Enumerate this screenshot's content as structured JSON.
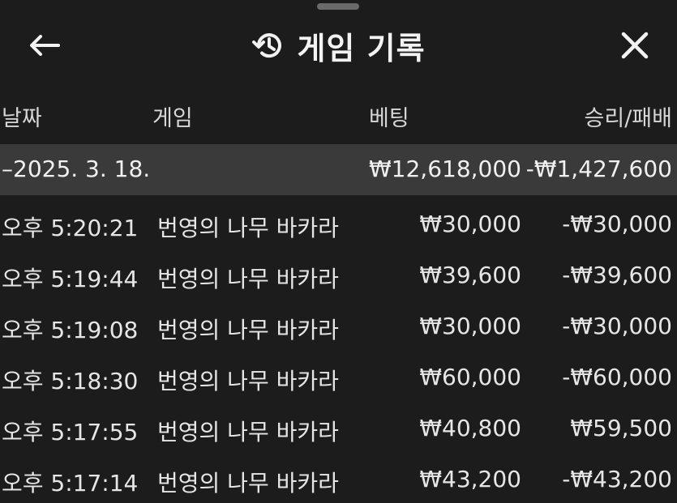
{
  "header": {
    "title": "게임 기록",
    "back_icon": "arrow-left-icon",
    "history_icon": "history-icon",
    "close_icon": "close-icon"
  },
  "columns": {
    "date": "날짜",
    "game": "게임",
    "bet": "베팅",
    "result": "승리/패배"
  },
  "summary": {
    "date": "–2025. 3. 18.",
    "bet": "₩12,618,000",
    "result": "-₩1,427,600"
  },
  "rows": [
    {
      "time": "오후 5:20:21",
      "game": "번영의 나무 바카라",
      "bet": "₩30,000",
      "result": "-₩30,000"
    },
    {
      "time": "오후 5:19:44",
      "game": "번영의 나무 바카라",
      "bet": "₩39,600",
      "result": "-₩39,600"
    },
    {
      "time": "오후 5:19:08",
      "game": "번영의 나무 바카라",
      "bet": "₩30,000",
      "result": "-₩30,000"
    },
    {
      "time": "오후 5:18:30",
      "game": "번영의 나무 바카라",
      "bet": "₩60,000",
      "result": "-₩60,000"
    },
    {
      "time": "오후 5:17:55",
      "game": "번영의 나무 바카라",
      "bet": "₩40,800",
      "result": "₩59,500"
    },
    {
      "time": "오후 5:17:14",
      "game": "번영의 나무 바카라",
      "bet": "₩43,200",
      "result": "-₩43,200"
    }
  ],
  "colors": {
    "background": "#1c1c1c",
    "summary_bg": "#3a3a3a",
    "text": "#e6e6e6"
  }
}
